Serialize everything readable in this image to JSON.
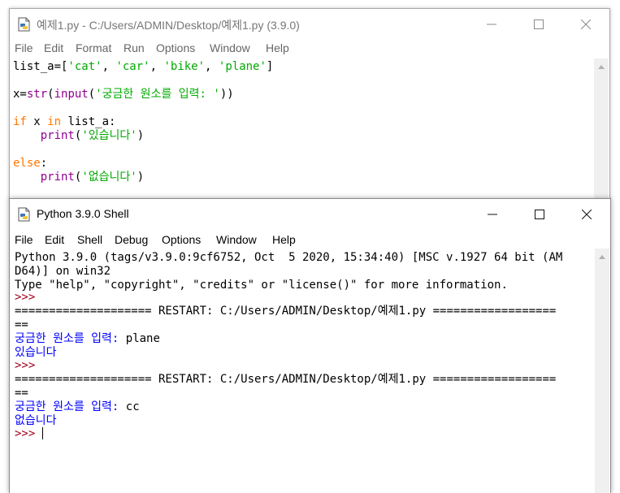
{
  "editor": {
    "title": "예제1.py - C:/Users/ADMIN/Desktop/예제1.py (3.9.0)",
    "menu": [
      "File",
      "Edit",
      "Format",
      "Run",
      "Options",
      "Window",
      "Help"
    ],
    "code": {
      "line1": {
        "a": "list_a=[",
        "b": "'cat'",
        "c": ", ",
        "d": "'car'",
        "e": ", ",
        "f": "'bike'",
        "g": ", ",
        "h": "'plane'",
        "i": "]"
      },
      "line2": {
        "a": "x=",
        "b": "str",
        "c": "(",
        "d": "input",
        "e": "(",
        "f": "'궁금한 원소를 입력: '",
        "g": "))"
      },
      "line3": {
        "a": "if",
        "b": " x ",
        "c": "in",
        "d": " list_a:"
      },
      "line4": {
        "a": "    ",
        "b": "print",
        "c": "(",
        "d": "'있습니다'",
        "e": ")"
      },
      "line5": {
        "a": "else",
        "b": ":"
      },
      "line6": {
        "a": "    ",
        "b": "print",
        "c": "(",
        "d": "'없습니다'",
        "e": ")"
      }
    }
  },
  "shell": {
    "title": "Python 3.9.0 Shell",
    "menu": [
      "File",
      "Edit",
      "Shell",
      "Debug",
      "Options",
      "Window",
      "Help"
    ],
    "lines": {
      "banner1": "Python 3.9.0 (tags/v3.9.0:9cf6752, Oct  5 2020, 15:34:40) [MSC v.1927 64 bit (AM",
      "banner2": "D64)] on win32",
      "banner3": "Type \"help\", \"copyright\", \"credits\" or \"license()\" for more information.",
      "prompt1": ">>>",
      "restart1": "==================== RESTART: C:/Users/ADMIN/Desktop/예제1.py ==================",
      "restart1_wrap": "==",
      "ask1_prompt": "궁금한 원소를 입력: ",
      "ask1_input": "plane",
      "out1": "있습니다",
      "prompt2": ">>>",
      "restart2": "==================== RESTART: C:/Users/ADMIN/Desktop/예제1.py ==================",
      "restart2_wrap": "==",
      "ask2_prompt": "궁금한 원소를 입력: ",
      "ask2_input": "cc",
      "out2": "없습니다",
      "prompt3": ">>> "
    }
  },
  "icons": {
    "window_icon": "python-file-icon",
    "minimize": "minimize-icon",
    "maximize": "maximize-icon",
    "close": "close-icon"
  },
  "colors": {
    "keyword": "#ff7700",
    "builtin": "#900090",
    "string": "#00aa00",
    "shell_stdout": "#0000ff",
    "shell_prompt": "#a0001e"
  }
}
